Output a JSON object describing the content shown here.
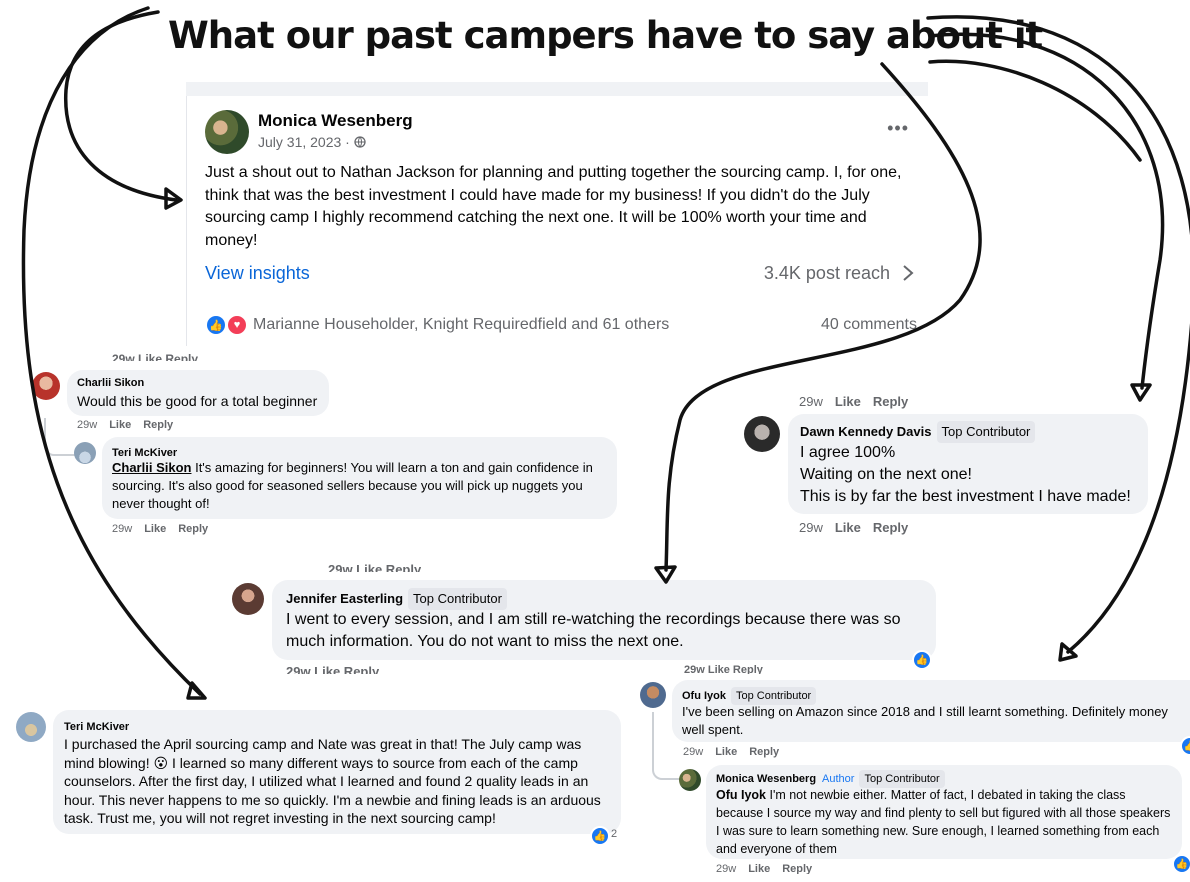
{
  "headline": "What our past campers have to say about it",
  "post": {
    "author": "Monica Wesenberg",
    "date": "July 31, 2023 · ",
    "globe_icon": "globe-icon",
    "more_label": "•••",
    "text": "Just a shout out to Nathan Jackson for planning and putting together the sourcing camp. I, for one, think that was the best investment I could have made for my business! If you didn't do the July sourcing camp I highly recommend catching the next one. It will be 100% worth your time and money!",
    "view_insights": "View insights",
    "reach": "3.4K post reach",
    "reactions_text": "Marianne Householder, Knight Requiredfield and 61 others",
    "comments": "40 comments"
  },
  "meta": {
    "like": "Like",
    "reply": "Reply"
  },
  "comments": {
    "charlii": {
      "name": "Charlii Sikon",
      "text": "Would this be good for a total beginner",
      "age": "29w"
    },
    "teri_reply": {
      "name": "Teri McKiver",
      "mention": "Charlii Sikon",
      "text": " It's amazing for beginners! You will learn a ton and gain confidence in sourcing. It's also good for seasoned sellers because you will pick up nuggets you never thought of!",
      "age": "29w"
    },
    "dawn": {
      "name": "Dawn Kennedy Davis",
      "badge": "Top Contributor",
      "lines": [
        "I agree 100%",
        "Waiting on the next one!",
        "This is by far the best investment I have made!"
      ],
      "age_top": "29w",
      "age": "29w"
    },
    "jennifer": {
      "name": "Jennifer Easterling",
      "badge": "Top Contributor",
      "text": "I went to every session, and I am still re-watching the recordings because there was so much information. You do not want to miss the next one.",
      "cut_top": "29w  Like  Reply",
      "cut_bottom": "29w  Like  Reply"
    },
    "teri": {
      "name": "Teri McKiver",
      "text": "I purchased the April sourcing camp and Nate was great in that! The July camp was mind blowing! 😮 I learned so many different ways to source from each of the camp counselors. After the first day, I utilized what I learned and found 2 quality leads in an hour. This never happens to me so quickly. I'm a newbie and fining leads is an arduous task. Trust me, you will not regret investing in the next sourcing camp!",
      "reaction_count": "2"
    },
    "ofu": {
      "name": "Ofu Iyok",
      "badge": "Top Contributor",
      "text": "I've been selling on Amazon since 2018 and I still learnt something. Definitely money well spent.",
      "age": "29w",
      "cut_top": "29w  Like  Reply"
    },
    "monica_reply": {
      "name": "Monica Wesenberg",
      "author_badge": "Author",
      "badge": "Top Contributor",
      "mention": "Ofu Iyok",
      "text": " I'm not newbie either. Matter of fact, I debated in taking the class because I source my way and find plenty to sell but figured with all those speakers I was sure to learn something new. Sure enough, I learned something from each and everyone of them",
      "age": "29w"
    }
  },
  "colors": {
    "accent": "#1877f2",
    "bubble": "#f0f2f5",
    "love": "#f33e58"
  }
}
